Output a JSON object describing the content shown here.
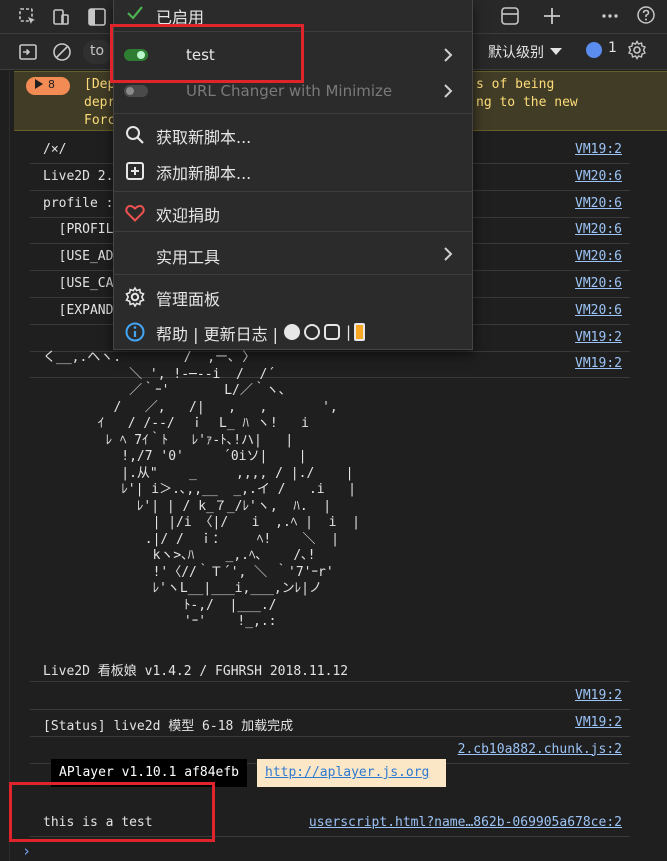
{
  "toolbar": {
    "filter_text": "to",
    "log_level": "默认级别",
    "message_count": "1"
  },
  "menu": {
    "enabled_label": "已启用",
    "scripts": [
      {
        "name": "test",
        "enabled": true
      },
      {
        "name": "URL Changer with Minimize",
        "enabled": false
      }
    ],
    "get_new_scripts": "获取新脚本...",
    "add_new_script": "添加新脚本...",
    "donate": "欢迎捐助",
    "utilities": "实用工具",
    "dashboard": "管理面板",
    "help_changelog": "帮助 | 更新日志 |"
  },
  "warning": {
    "count": "8",
    "line1_left": "[Dep",
    "line1_right": "s of being",
    "line2_left": "depr",
    "line2_right": "ng to the new",
    "line3_left": "Forc"
  },
  "console_rows": [
    {
      "text": "/×/",
      "source": "VM19:2"
    },
    {
      "text": "Live2D 2.",
      "source": "VM20:6"
    },
    {
      "text": "profile :",
      "source": "VM20:6"
    },
    {
      "text": "  [PROFIL",
      "source": "VM20:6"
    },
    {
      "text": "  [USE_AD",
      "source": "VM20:6"
    },
    {
      "text": "  [USE_CA",
      "source": "VM20:6"
    },
    {
      "text": "  [EXPAND",
      "source": "VM20:6"
    },
    {
      "text": "",
      "source": "VM19:2"
    },
    {
      "text": "",
      "source": "VM19:2"
    }
  ],
  "ascii_art": "く__,.ヘヽ.        /  ,ー､ 〉\n           ＼ ', !-─‐-i  /  /´\n           ／｀ｰ'       L/／｀ヽ､\n         /   ／,   /|   ,   ,       ',\n       ｲ   / /-‐/  ｉ  L_ ﾊ ヽ!   i\n        ﾚ ﾍ 7ｲ｀ﾄ   ﾚ'ｧ-ﾄ､!ハ|   |\n          !,/7 '0'     ´0iソ|    |\n          |.从\"    _     ,,,, / |./    |\n          ﾚ'| i＞.､,,__  _,.イ /   .i   |\n            ﾚ'| | / k_７_/ﾚ'ヽ,  ﾊ.  |\n              | |/i 〈|/   i  ,.ﾍ |  i  |\n             .|/ /  ｉ：    ﾍ!    ＼  |\n              kヽ>､ﾊ    _,.ﾍ､    /､!\n              !'〈//｀Ｔ´', ＼ ｀'7'ｰr'\n              ﾚ'ヽL__|___i,___,ンﾚ|ノ\n                  ﾄ-,/  |___./\n                  'ｰ'    !_,.:",
  "live2d_line": {
    "text": "Live2D 看板娘 v1.4.2 / FGHRSH 2018.11.12",
    "source": ""
  },
  "after_rows": [
    {
      "text": "",
      "source": "VM19:2"
    },
    {
      "text": "[Status] live2d 模型 6-18 加载完成",
      "source": "VM19:2"
    },
    {
      "text": "",
      "source": "2.cb10a882.chunk.js:2"
    }
  ],
  "aplayer": {
    "version": "APlayer v1.10.1 af84efb",
    "link": "http://aplayer.js.org"
  },
  "test_line": {
    "text": "this is a test",
    "source": "userscript.html?name…862b-069905a678ce:2"
  }
}
